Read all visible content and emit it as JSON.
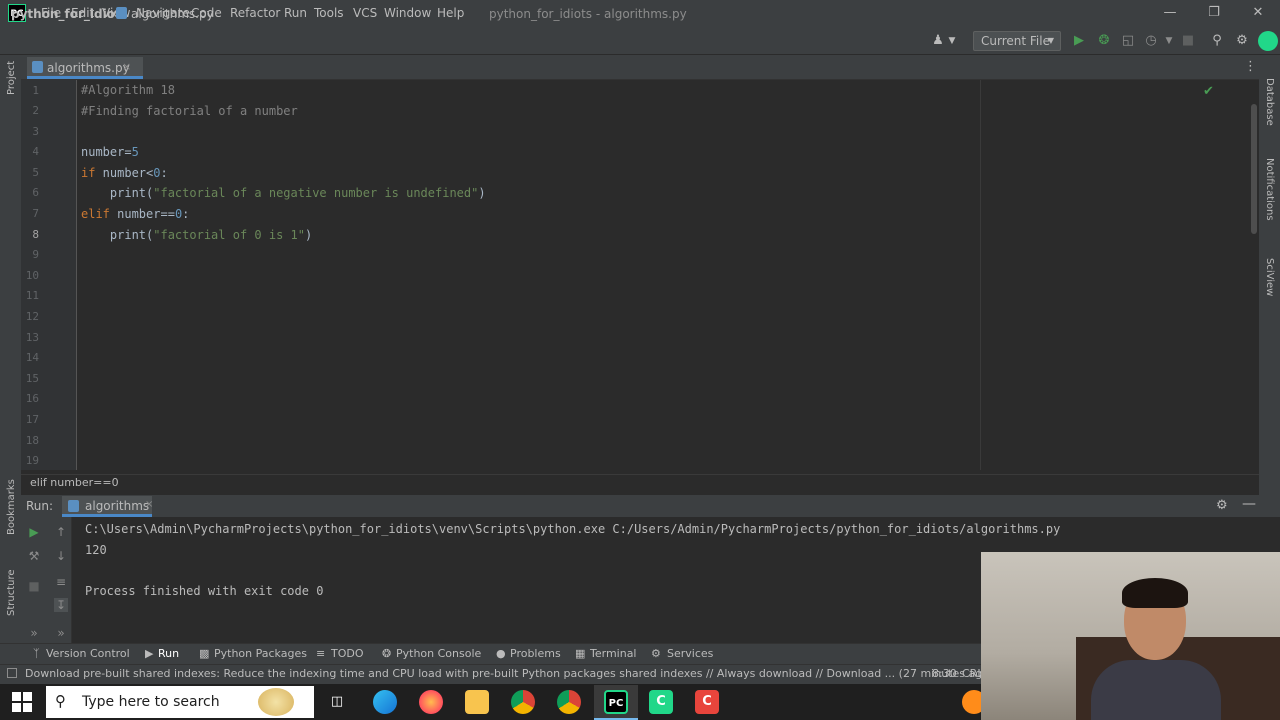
{
  "app": {
    "logo_text": "PC",
    "window_title": "python_for_idiots - algorithms.py",
    "menu": [
      "File",
      "Edit",
      "View",
      "Navigate",
      "Code",
      "Refactor",
      "Run",
      "Tools",
      "VCS",
      "Window",
      "Help"
    ]
  },
  "navbar": {
    "project": "python_for_idiots",
    "file": "algorithms.py",
    "run_config": "Current File"
  },
  "left_strip": {
    "project_label": "Project",
    "bookmarks_label": "Bookmarks",
    "structure_label": "Structure"
  },
  "right_strip": {
    "database_label": "Database",
    "notifications_label": "Notifications",
    "sciview_label": "SciView"
  },
  "editor": {
    "tab_label": "algorithms.py",
    "line_numbers": [
      "1",
      "2",
      "3",
      "4",
      "5",
      "6",
      "7",
      "8",
      "9",
      "10",
      "11",
      "12",
      "13",
      "14",
      "15",
      "16",
      "17",
      "18",
      "19"
    ],
    "breadcrumb": "elif number==0"
  },
  "run_panel": {
    "title": "Run:",
    "tab_label": "algorithms",
    "console": [
      "C:\\Users\\Admin\\PycharmProjects\\python_for_idiots\\venv\\Scripts\\python.exe C:/Users/Admin/PycharmProjects/python_for_idiots/algorithms.py",
      "120",
      "",
      "Process finished with exit code 0"
    ]
  },
  "bottom_tools": {
    "version_control": "Version Control",
    "run": "Run",
    "python_packages": "Python Packages",
    "todo": "TODO",
    "python_console": "Python Console",
    "problems": "Problems",
    "terminal": "Terminal",
    "services": "Services"
  },
  "status": {
    "message": "Download pre-built shared indexes: Reduce the indexing time and CPU load with pre-built Python packages shared indexes // Always download // Download ... (27 minutes ago)",
    "position": "8:30",
    "line_ending": "CRL"
  },
  "taskbar": {
    "search_placeholder": "Type here to search"
  },
  "colors": {
    "accent": "#4a88c7",
    "keyword": "#cc7832",
    "number": "#6897bb",
    "string": "#6a8759",
    "comment": "#808080"
  }
}
